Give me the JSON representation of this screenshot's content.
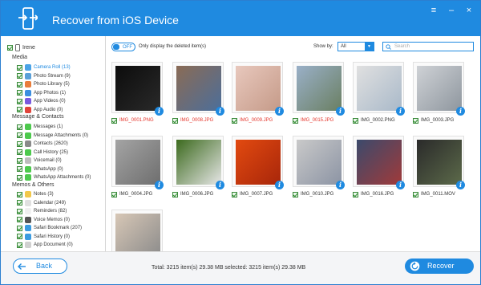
{
  "window": {
    "title": "Recover from iOS Device"
  },
  "device": {
    "name": "Irene"
  },
  "sections": {
    "media": "Media",
    "messages": "Message & Contacts",
    "memos": "Memos & Others"
  },
  "media_items": [
    {
      "label": "Camera Roll (13)",
      "icon": "camera-roll-icon",
      "color": "#4aa3e6",
      "active": true
    },
    {
      "label": "Photo Stream (9)",
      "icon": "photo-stream-icon",
      "color": "#5aa0d8"
    },
    {
      "label": "Photo Library (5)",
      "icon": "photo-library-icon",
      "color": "#e97d3b"
    },
    {
      "label": "App Photos (1)",
      "icon": "app-photos-icon",
      "color": "#3b8fe0"
    },
    {
      "label": "App Videos (0)",
      "icon": "app-videos-icon",
      "color": "#7a5ae0"
    },
    {
      "label": "App Audio (0)",
      "icon": "app-audio-icon",
      "color": "#e0443b"
    }
  ],
  "message_items": [
    {
      "label": "Messages (1)",
      "icon": "messages-icon",
      "color": "#4cc94c"
    },
    {
      "label": "Message Attachments (0)",
      "icon": "message-attachments-icon",
      "color": "#4cc94c"
    },
    {
      "label": "Contacts (2620)",
      "icon": "contacts-icon",
      "color": "#8a8a8a"
    },
    {
      "label": "Call History (25)",
      "icon": "call-history-icon",
      "color": "#4cc94c"
    },
    {
      "label": "Voicemail (0)",
      "icon": "voicemail-icon",
      "color": "#bdbdbd"
    },
    {
      "label": "WhatsApp (0)",
      "icon": "whatsapp-icon",
      "color": "#4cc94c"
    },
    {
      "label": "WhatsApp Attachments (0)",
      "icon": "whatsapp-attachments-icon",
      "color": "#4cc94c"
    }
  ],
  "memo_items": [
    {
      "label": "Notes (3)",
      "icon": "notes-icon",
      "color": "#f2c84b"
    },
    {
      "label": "Calendar (249)",
      "icon": "calendar-icon",
      "color": "#e0e0e0"
    },
    {
      "label": "Reminders (82)",
      "icon": "reminders-icon",
      "color": "#f0f0f0"
    },
    {
      "label": "Voice Memos (0)",
      "icon": "voice-memos-icon",
      "color": "#555555"
    },
    {
      "label": "Safari Bookmark (207)",
      "icon": "safari-bookmark-icon",
      "color": "#3b9be0"
    },
    {
      "label": "Safari History (0)",
      "icon": "safari-history-icon",
      "color": "#3b9be0"
    },
    {
      "label": "App Document (0)",
      "icon": "app-document-icon",
      "color": "#d0d0d0"
    }
  ],
  "toolbar": {
    "toggle_state": "OFF",
    "only_deleted_label": "Only display the deleted item(s)",
    "show_by_label": "Show by:",
    "show_by_value": "All",
    "search_placeholder": "Search"
  },
  "photos": [
    {
      "name": "IMG_0001.PNG",
      "deleted": true,
      "colors": [
        "#0c0c0c",
        "#2a2a2a"
      ]
    },
    {
      "name": "IMG_0008.JPG",
      "deleted": true,
      "colors": [
        "#8a6b55",
        "#4c6e9a"
      ]
    },
    {
      "name": "IMG_0009.JPG",
      "deleted": true,
      "colors": [
        "#e8c8bd",
        "#c59a88"
      ]
    },
    {
      "name": "IMG_0015.JPG",
      "deleted": true,
      "colors": [
        "#9ab0c8",
        "#6a7f62"
      ]
    },
    {
      "name": "IMG_0002.PNG",
      "deleted": false,
      "colors": [
        "#e0e0e0",
        "#a9b9c9"
      ]
    },
    {
      "name": "IMG_0003.JPG",
      "deleted": false,
      "colors": [
        "#cfd2d6",
        "#8e969e"
      ]
    },
    {
      "name": "IMG_0004.JPG",
      "deleted": false,
      "colors": [
        "#a4a4a4",
        "#6e6e6e"
      ]
    },
    {
      "name": "IMG_0006.JPG",
      "deleted": false,
      "colors": [
        "#3c6a1e",
        "#e6e6e6"
      ]
    },
    {
      "name": "IMG_0007.JPG",
      "deleted": false,
      "colors": [
        "#e24a10",
        "#a8260a"
      ]
    },
    {
      "name": "IMG_0010.JPG",
      "deleted": false,
      "colors": [
        "#c9c9c9",
        "#8c94a4"
      ]
    },
    {
      "name": "IMG_0016.JPG",
      "deleted": false,
      "colors": [
        "#3b4a6c",
        "#a03a3a"
      ]
    },
    {
      "name": "IMG_0011.MOV",
      "deleted": false,
      "colors": [
        "#2a2a2a",
        "#5c6a4a"
      ]
    },
    {
      "name": "",
      "deleted": false,
      "colors": [
        "#d7c7b6",
        "#8a8a8a"
      ]
    }
  ],
  "footer": {
    "back_label": "Back",
    "totals": "Total: 3215 item(s) 29.38 MB   selected: 3215 item(s) 29.38 MB",
    "recover_label": "Recover"
  },
  "colors": {
    "accent": "#1f8ae0",
    "deleted": "#e4342a"
  }
}
